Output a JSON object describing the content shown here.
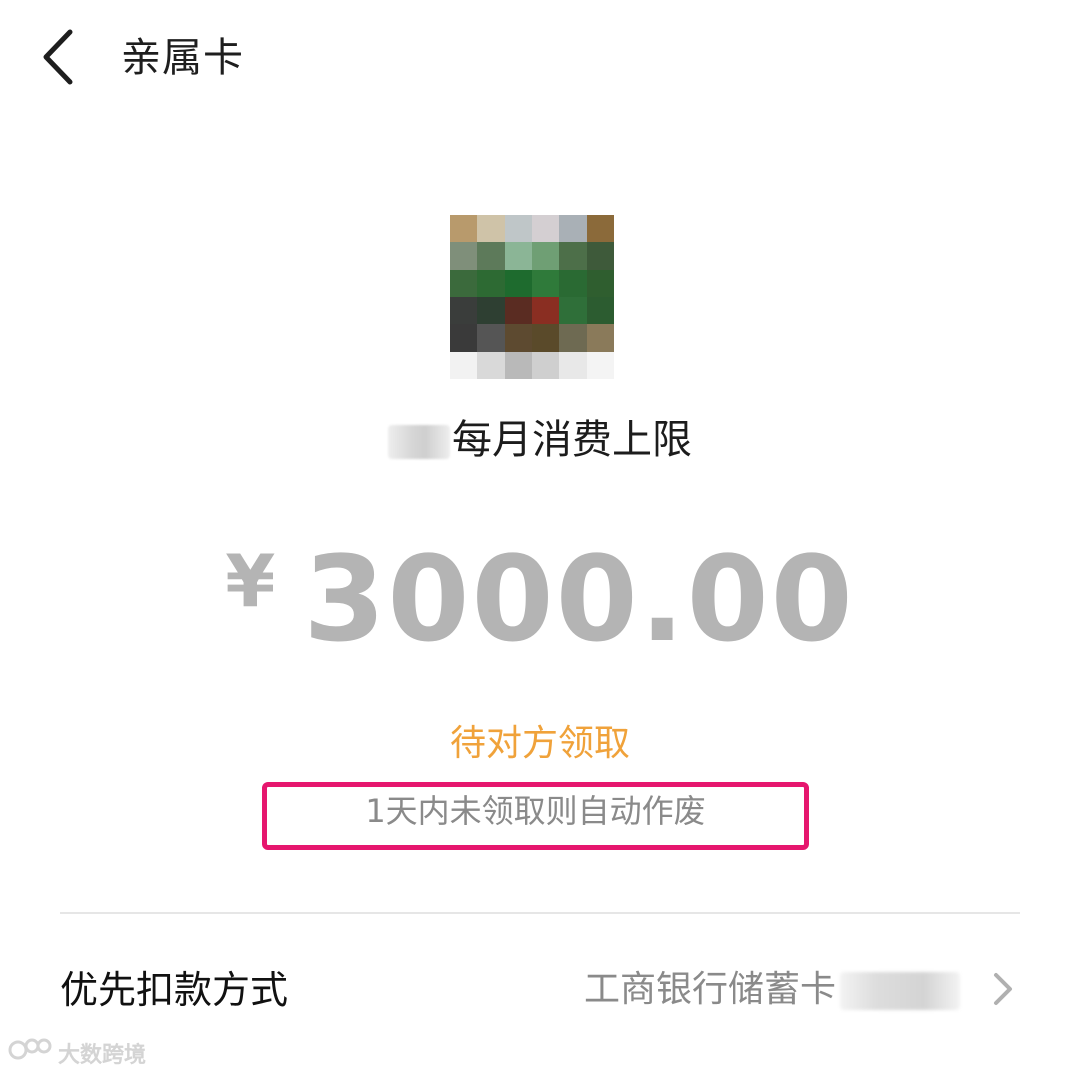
{
  "header": {
    "title": "亲属卡",
    "back_icon": "chevron-left-icon"
  },
  "avatar": {
    "alt": "pixelated profile image"
  },
  "card": {
    "limit_label": "每月消费上限",
    "currency_symbol": "¥",
    "amount": "3000.00",
    "status": "待对方领取",
    "notice": "1天内未领取则自动作废"
  },
  "payment": {
    "label": "优先扣款方式",
    "value": "工商银行储蓄卡",
    "chevron_icon": "chevron-right-icon"
  },
  "watermark": {
    "text": "大数跨境"
  },
  "colors": {
    "status_orange": "#f0a23a",
    "highlight_box": "#e6166e",
    "amount_gray": "#b4b4b4",
    "muted_text": "#8a8a8a"
  }
}
